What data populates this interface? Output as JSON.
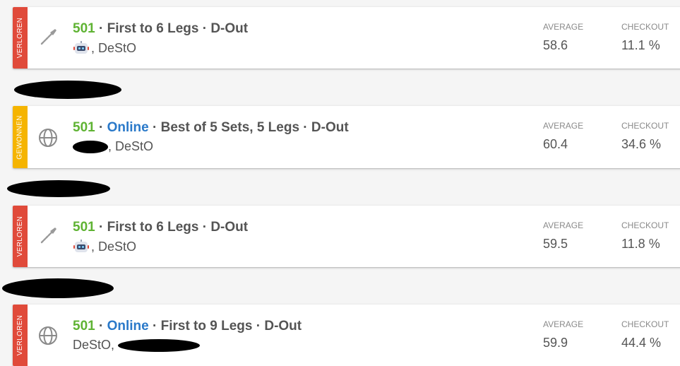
{
  "matches": [
    {
      "status": "VERLOREN",
      "status_color": "#e04a3a",
      "icon": "dart-icon",
      "score": "501",
      "online": "",
      "format": "First to 6 Legs · D-Out",
      "players_prefix": "",
      "players": ", DeStO",
      "average_label": "AVERAGE",
      "average": "58.6",
      "checkout_label": "CHECKOUT",
      "checkout": "11.1 %"
    },
    {
      "status": "GEWONNEN",
      "status_color": "#f5b400",
      "icon": "globe-icon",
      "score": "501",
      "online": "Online",
      "format": "Best of 5 Sets, 5 Legs · D-Out",
      "players_prefix": "",
      "players": ", DeStO",
      "average_label": "AVERAGE",
      "average": "60.4",
      "checkout_label": "CHECKOUT",
      "checkout": "34.6 %"
    },
    {
      "status": "VERLOREN",
      "status_color": "#e04a3a",
      "icon": "dart-icon",
      "score": "501",
      "online": "",
      "format": "First to 6 Legs · D-Out",
      "players_prefix": "",
      "players": ", DeStO",
      "average_label": "AVERAGE",
      "average": "59.5",
      "checkout_label": "CHECKOUT",
      "checkout": "11.8 %"
    },
    {
      "status": "VERLOREN",
      "status_color": "#e04a3a",
      "icon": "globe-icon",
      "score": "501",
      "online": "Online",
      "format": "First to 9 Legs · D-Out",
      "players_prefix": "DeStO, ",
      "players": "",
      "average_label": "AVERAGE",
      "average": "59.9",
      "checkout_label": "CHECKOUT",
      "checkout": "44.4 %"
    }
  ]
}
